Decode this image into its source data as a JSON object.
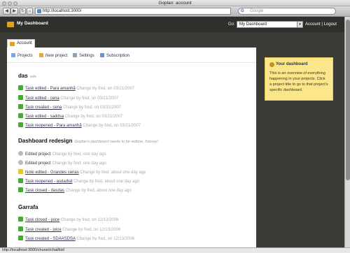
{
  "browser": {
    "window_title": "Goplan: account",
    "back_glyph": "◀",
    "forward_glyph": "▶",
    "reload_glyph": "↻",
    "home_glyph": "⌂",
    "url": "http://localhost:3000/",
    "search_engine_glyph": "G",
    "search_placeholder": "Google",
    "status_text": "http://localhost:3000/churari/chat/list/"
  },
  "header": {
    "brand": "My Dashboard",
    "goto_label": "Go:",
    "goto_selected": "My Dashboard",
    "goto_arrow": "▾",
    "account_link": "Account",
    "separator": " | ",
    "logout_link": "Logout"
  },
  "tabs": {
    "account_label": "Account"
  },
  "subnav": {
    "projects": "Projects",
    "new_project": "New project",
    "settings": "Settings",
    "subscription": "Subscription"
  },
  "sections": [
    {
      "title": "das",
      "desc": "sda",
      "rows": [
        {
          "link": "Task edited - Para amanhã",
          "meta": "Change by fred, on 03/21/2007"
        },
        {
          "link": "Task edited - cena",
          "meta": "Change by fred, on 03/21/2007"
        },
        {
          "link": "Task created - cena",
          "meta": "Change by fred, on 03/21/2007"
        },
        {
          "link": "Task edited - saddsa",
          "meta": "Change by fred, on 03/21/2007"
        },
        {
          "link": "Task reopened - Para amanhã",
          "meta": "Change by fred, on 03/21/2007"
        }
      ]
    },
    {
      "title": "Dashboard redesign",
      "desc": "Goplan's dashboard needs to be redone, hooray!",
      "rows": [
        {
          "link": "Edited project",
          "meta": "Change by fred, one day ago"
        },
        {
          "link": "Edited project",
          "meta": "Change by fred, one day ago"
        },
        {
          "link": "Note edited - Grandes cenas",
          "meta": "Change by fred, about one day ago"
        },
        {
          "link": "Task reopened - asdadsd",
          "meta": "Change by fred, about one day ago"
        },
        {
          "link": "Task closed - dasdas",
          "meta": "Change by fred, about one day ago"
        }
      ]
    },
    {
      "title": "Garrafa",
      "desc": "",
      "rows": [
        {
          "link": "Task closed - joice",
          "meta": "Change by fred, on 12/13/2006"
        },
        {
          "link": "Task created - joice",
          "meta": "Change by fred, on 12/13/2006"
        },
        {
          "link": "Task created - SDAASDSA",
          "meta": "Change by fred, on 12/13/2006"
        }
      ]
    }
  ],
  "sidebar": {
    "title": "Your dashboard",
    "body": "This is an overview of everything happening in your projects. Click a project title to go to that project's specific dashboard."
  }
}
